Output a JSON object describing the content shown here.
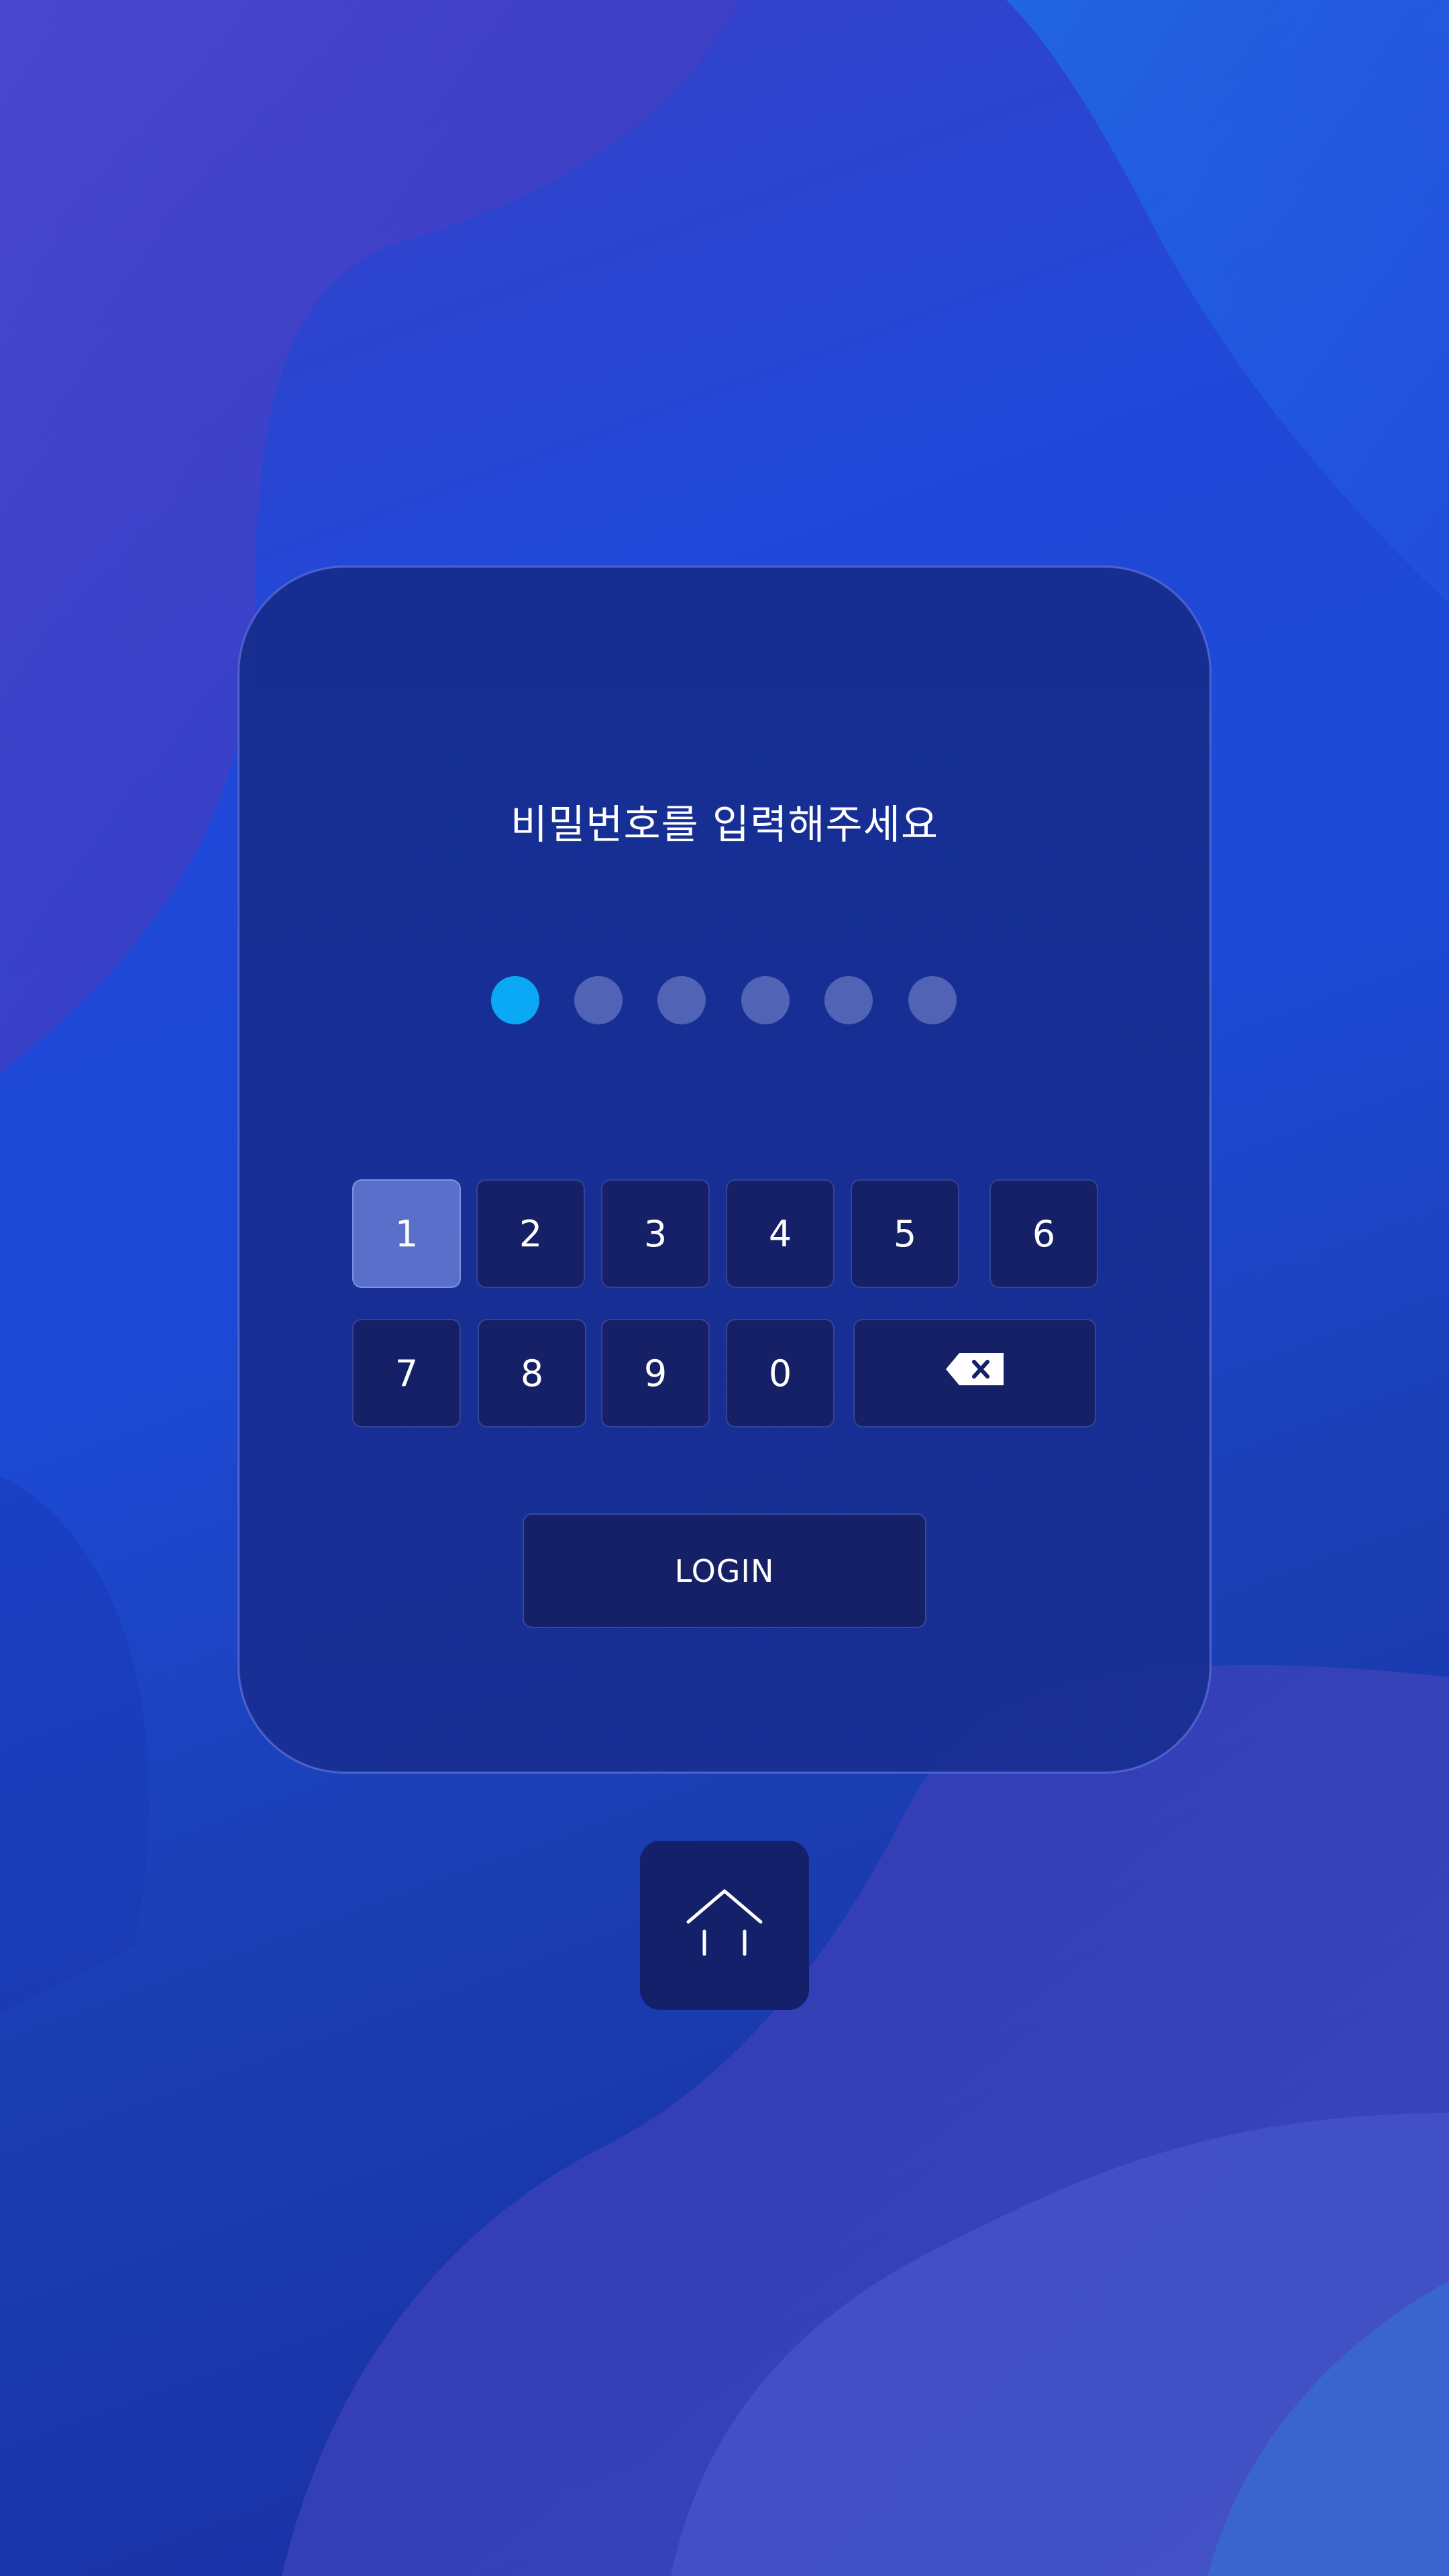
{
  "prompt": {
    "title": "비밀번호를 입력해주세요"
  },
  "pin": {
    "length": 6,
    "filled_count": 1,
    "filled_color": "#0ba8f5",
    "empty_color": "#5063b4"
  },
  "keypad": {
    "keys": [
      "1",
      "2",
      "3",
      "4",
      "5",
      "6",
      "7",
      "8",
      "9",
      "0"
    ],
    "active_key": "1",
    "backspace_icon": "backspace-icon"
  },
  "login": {
    "label": "LOGIN"
  },
  "home": {
    "icon": "home-icon"
  },
  "colors": {
    "key_background": "#152066",
    "key_active_background": "#5a6fc9",
    "accent": "#0ba8f5"
  }
}
